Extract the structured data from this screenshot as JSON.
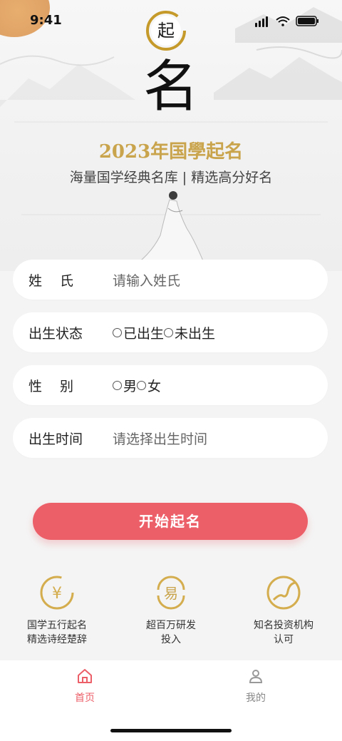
{
  "status_bar": {
    "time": "9:41"
  },
  "hero": {
    "seal_char": "起",
    "big_char": "名",
    "title": "2023年国學起名",
    "subtitle": "海量国学经典名库 | 精选高分好名"
  },
  "form": {
    "surname": {
      "label": "姓　 氏",
      "placeholder": "请输入姓氏"
    },
    "birth_status": {
      "label": "出生状态",
      "options": [
        "已出生",
        "未出生"
      ]
    },
    "gender": {
      "label": "性　 别",
      "options": [
        "男",
        "女"
      ]
    },
    "birth_time": {
      "label": "出生时间",
      "placeholder": "请选择出生时间"
    }
  },
  "start_button": {
    "label": "开始起名"
  },
  "features": [
    {
      "icon": "yuan-coin-icon",
      "line1": "国学五行起名",
      "line2": "精选诗经楚辞"
    },
    {
      "icon": "yi-character-icon",
      "line1": "超百万研发",
      "line2": "投入"
    },
    {
      "icon": "chart-circle-icon",
      "line1": "知名投资机构",
      "line2": "认可"
    }
  ],
  "tab_bar": {
    "home": {
      "label": "首页",
      "icon": "home-icon",
      "color": "#ec5f69"
    },
    "mine": {
      "label": "我的",
      "icon": "user-icon",
      "color": "#888888"
    }
  },
  "colors": {
    "accent": "#ec5f69",
    "gold": "#c9a44c"
  }
}
